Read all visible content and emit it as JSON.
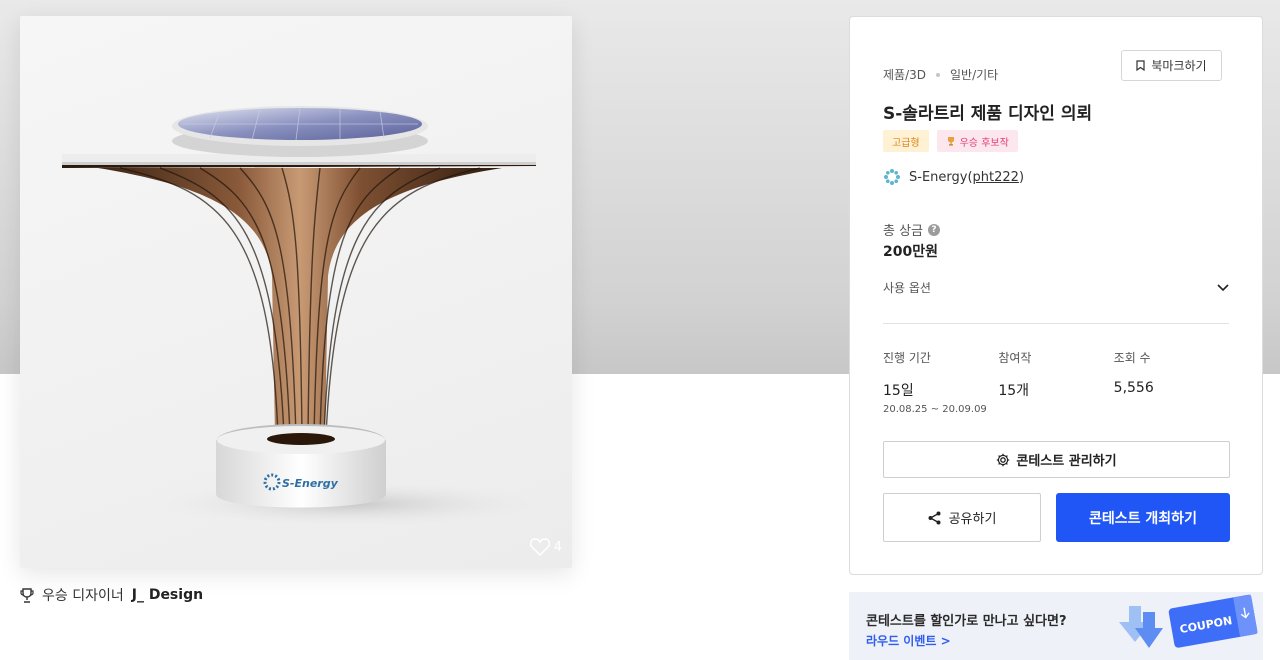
{
  "product": {
    "like_count": "4"
  },
  "designer": {
    "prefix": "우승 디자이너",
    "name": "J_ Design"
  },
  "info": {
    "category": "제품/3D",
    "subcategory": "일반/기타",
    "bookmark_label": "북마크하기",
    "title": "S-솔라트리 제품 디자인 의뢰",
    "badges": {
      "premium": "고급형",
      "runner": "우승 후보작"
    },
    "owner": {
      "name": "S-Energy",
      "handle": "pht222",
      "paren_open": "(",
      "paren_close": ")"
    },
    "prize_label": "총 상금",
    "prize_help": "?",
    "prize_value": "200만원",
    "usage_label": "사용 옵션",
    "stats": {
      "period_label": "진행 기간",
      "period_value": "15일",
      "period_range": "20.08.25 ~ 20.09.09",
      "entries_label": "참여작",
      "entries_value": "15개",
      "views_label": "조회 수",
      "views_value": "5,556"
    },
    "manage_label": "콘테스트 관리하기",
    "share_label": "공유하기",
    "host_label": "콘테스트 개최하기"
  },
  "banner": {
    "title": "콘테스트를 할인가로 만나고 싶다면?",
    "link": "라우드 이벤트 >",
    "coupon_text": "COUPON"
  },
  "colors": {
    "primary": "#2156f6",
    "premium_bg": "#fff1d4",
    "runner_bg": "#fde7ee"
  }
}
